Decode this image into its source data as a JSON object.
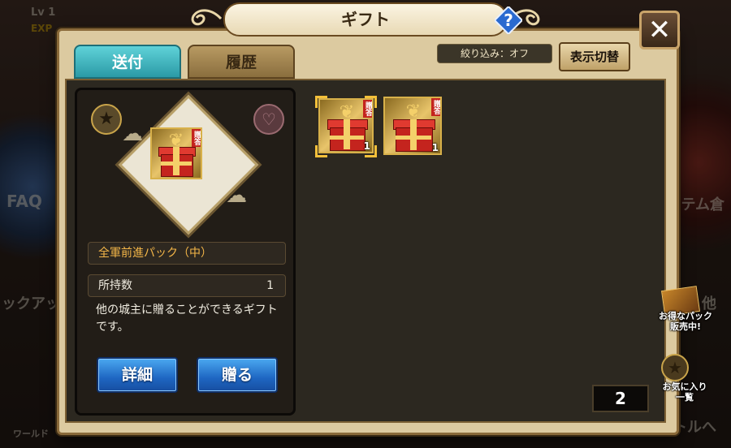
{
  "background": {
    "level": "Lv 1",
    "exp": "EXP",
    "faq": "FAQ",
    "item_storage": "イテム倉",
    "control": "ックアッ",
    "other": "他",
    "world": "ワールド",
    "battle": "トルへ"
  },
  "dialog": {
    "title": "ギフト",
    "help_icon": "question-icon",
    "help_label": "?",
    "close_label": "✕",
    "tabs": [
      {
        "label": "送付",
        "active": true
      },
      {
        "label": "履歴",
        "active": false
      }
    ],
    "filter_label": "絞り込み：オフ",
    "toggle_view_label": "表示切替",
    "selected_item": {
      "tag": "贈答",
      "name": "全軍前進パック（中）",
      "owned_label": "所持数",
      "owned_value": "1",
      "description": "他の城主に贈ることができるギフトです。",
      "detail_button": "詳細",
      "send_button": "贈る"
    },
    "inventory": [
      {
        "icon": "gift-box-icon",
        "tag": "贈答",
        "count": "1",
        "selected": true
      },
      {
        "icon": "gift-box-icon",
        "tag": "贈答",
        "count": "1",
        "selected": false
      }
    ],
    "page_indicator": "2"
  },
  "side_menu": {
    "promo_line1": "お得なパック",
    "promo_line2": "販売中!",
    "favorites_line1": "お気に入り",
    "favorites_line2": "一覧"
  },
  "colors": {
    "tab_active": "#2b9aa6",
    "button_blue": "#1e66c2",
    "item_name": "#f4b648",
    "gift_red": "#c4241e",
    "gold": "#f4d06a"
  }
}
